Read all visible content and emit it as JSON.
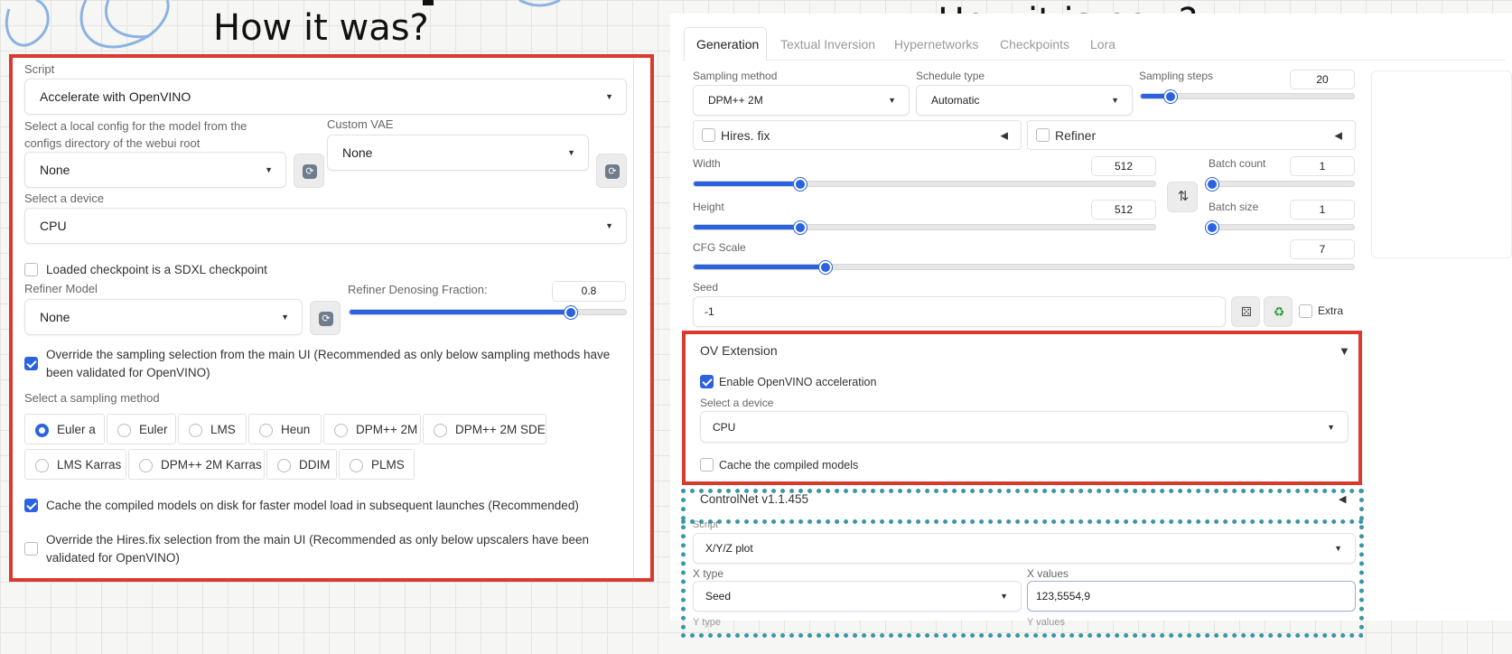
{
  "headings": {
    "left": "How it was?",
    "right": "How it is now?"
  },
  "old_ui": {
    "script_label": "Script",
    "script_value": "Accelerate with OpenVINO",
    "config_label": "Select a local config for the model from the configs directory of the webui root",
    "config_value": "None",
    "vae_label": "Custom VAE",
    "vae_value": "None",
    "device_label": "Select a device",
    "device_value": "CPU",
    "sdxl_label": "Loaded checkpoint is a SDXL checkpoint",
    "refiner_label": "Refiner Model",
    "refiner_value": "None",
    "denoise_label": "Refiner Denosing Fraction:",
    "denoise_value": "0.8",
    "denoise_fraction": 0.8,
    "override_label": "Override the sampling selection from the main UI (Recommended as only below sampling methods have been validated for OpenVINO)",
    "sampling_label": "Select a sampling method",
    "samplers": [
      "Euler a",
      "Euler",
      "LMS",
      "Heun",
      "DPM++ 2M",
      "DPM++ 2M SDE",
      "LMS Karras",
      "DPM++ 2M Karras",
      "DDIM",
      "PLMS"
    ],
    "selected_sampler": "Euler a",
    "cache_label": "Cache the compiled models on disk for faster model load in subsequent launches (Recommended)",
    "hires_label": "Override the Hires.fix selection from the main UI (Recommended as only below upscalers have been validated for OpenVINO)"
  },
  "new_ui": {
    "tabs": [
      "Generation",
      "Textual Inversion",
      "Hypernetworks",
      "Checkpoints",
      "Lora"
    ],
    "active_tab": "Generation",
    "sampling_method_label": "Sampling method",
    "sampling_method_value": "DPM++ 2M",
    "schedule_label": "Schedule type",
    "schedule_value": "Automatic",
    "steps_label": "Sampling steps",
    "steps_value": "20",
    "hires_label": "Hires. fix",
    "refiner_label": "Refiner",
    "width_label": "Width",
    "width_value": "512",
    "height_label": "Height",
    "height_value": "512",
    "batch_count_label": "Batch count",
    "batch_count_value": "1",
    "batch_size_label": "Batch size",
    "batch_size_value": "1",
    "cfg_label": "CFG Scale",
    "cfg_value": "7",
    "seed_label": "Seed",
    "seed_value": "-1",
    "extra_label": "Extra",
    "ov_title": "OV Extension",
    "ov_enable_label": "Enable OpenVINO acceleration",
    "ov_device_label": "Select a device",
    "ov_device_value": "CPU",
    "ov_cache_label": "Cache the compiled models",
    "controlnet_label": "ControlNet v1.1.455",
    "script_label": "Script",
    "script_value": "X/Y/Z plot",
    "xtype_label": "X type",
    "xtype_value": "Seed",
    "xvalues_label": "X values",
    "xvalues_value": "123,5554,9",
    "ytype_label": "Y type",
    "yvalues_label": "Y values"
  },
  "colors": {
    "highlight_red": "#d93a2f",
    "dotted_teal": "#3a97a6",
    "accent_blue": "#2a62e0"
  }
}
